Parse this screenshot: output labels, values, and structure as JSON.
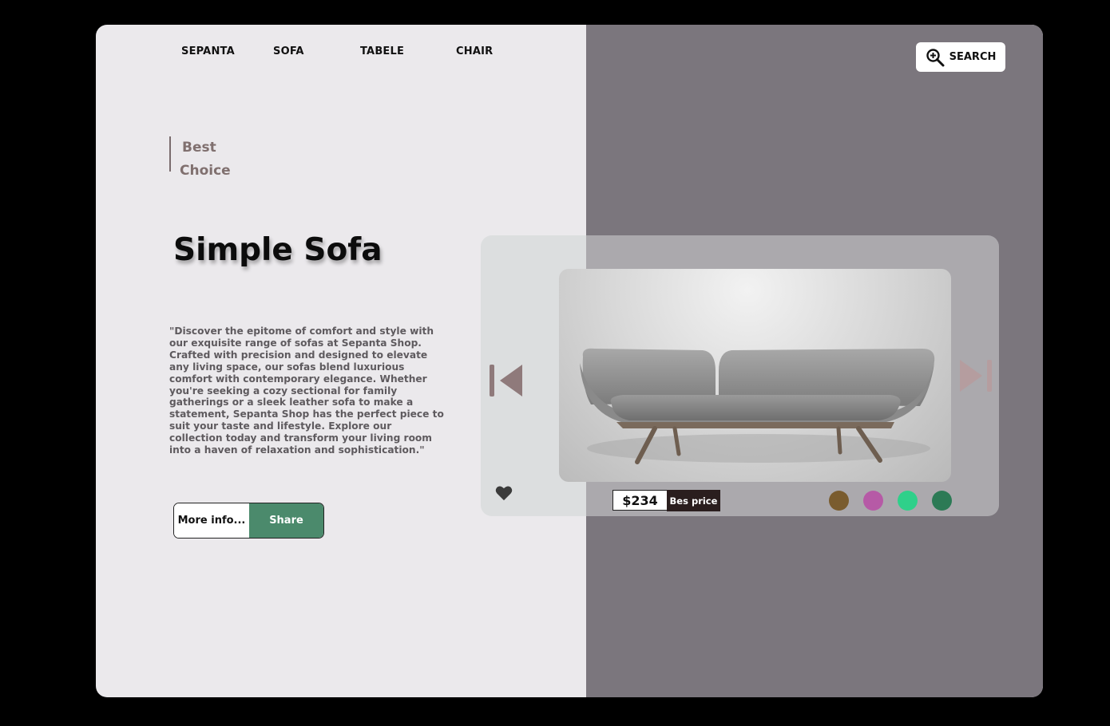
{
  "nav": {
    "items": [
      {
        "label": "SEPANTA"
      },
      {
        "label": "SOFA"
      },
      {
        "label": "TABELE"
      },
      {
        "label": "CHAIR"
      }
    ]
  },
  "search": {
    "label": "SEARCH",
    "icon": "search-plus-icon"
  },
  "hero": {
    "badge_line1": "Best",
    "badge_line2": "Choice",
    "title": "Simple Sofa",
    "description": "\"Discover the epitome of comfort and style with our exquisite range of sofas at Sepanta Shop. Crafted with precision and designed to elevate any living space, our sofas blend luxurious comfort with contemporary elegance. Whether you're seeking a cozy sectional for family gatherings or a sleek leather sofa to make a statement, Sepanta Shop has the perfect piece to suit your taste and lifestyle. Explore our collection today and transform your living room into a haven of relaxation and sophistication.\""
  },
  "actions": {
    "more_label": "More info...",
    "share_label": "Share"
  },
  "product": {
    "image": "sofa-photo",
    "price": "$234",
    "price_tag": "Bes price",
    "colors": [
      "#7a5c2e",
      "#b65aa6",
      "#2fd08a",
      "#2c7a55"
    ]
  },
  "theme": {
    "left_bg": "#ebe9ec",
    "right_bg": "#7b767d",
    "share_green": "#4b8a6c"
  }
}
